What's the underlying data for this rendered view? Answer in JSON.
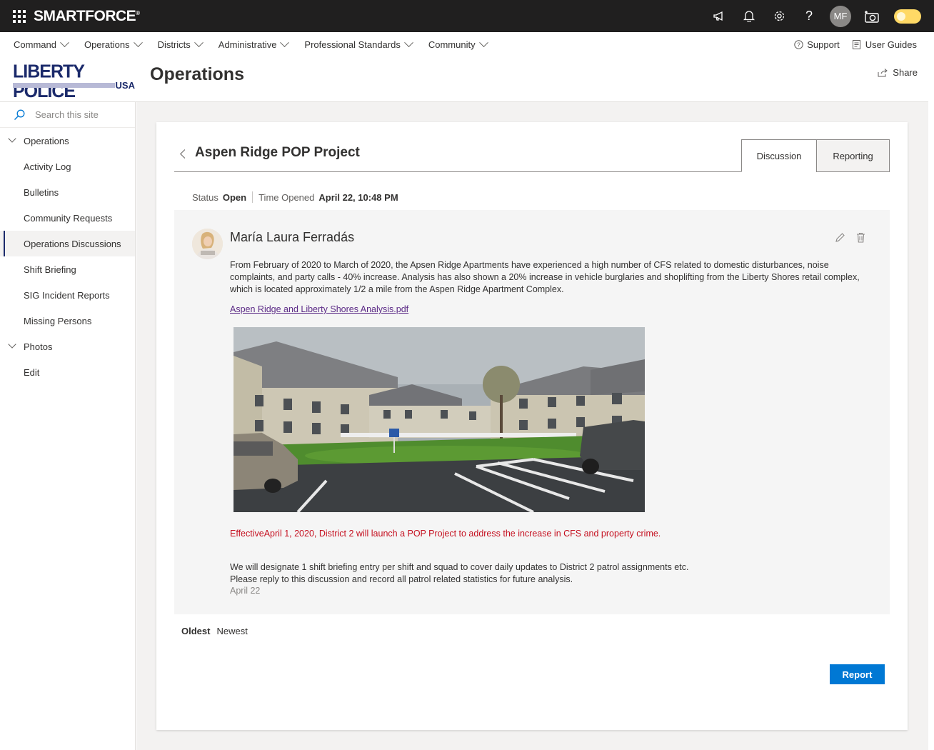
{
  "suite": {
    "brand": "SMARTFORCE",
    "brand_mark": "®",
    "user_initials": "MF",
    "icons": [
      "megaphone-icon",
      "bell-icon",
      "gear-icon",
      "help-icon",
      "camera-icon"
    ]
  },
  "topnav": {
    "items": [
      {
        "label": "Command"
      },
      {
        "label": "Operations"
      },
      {
        "label": "Districts"
      },
      {
        "label": "Administrative"
      },
      {
        "label": "Professional Standards"
      },
      {
        "label": "Community"
      }
    ],
    "support_label": "Support",
    "guides_label": "User Guides"
  },
  "site": {
    "logo_text": "LIBERTY POLICE",
    "logo_sub": "USA",
    "title": "Operations",
    "share_label": "Share"
  },
  "leftnav": {
    "search_placeholder": "Search this site",
    "items": [
      {
        "label": "Operations",
        "expandable": true
      },
      {
        "label": "Activity Log"
      },
      {
        "label": "Bulletins"
      },
      {
        "label": "Community Requests"
      },
      {
        "label": "Operations Discussions",
        "selected": true
      },
      {
        "label": "Shift Briefing"
      },
      {
        "label": "SIG Incident Reports"
      },
      {
        "label": "Missing Persons"
      },
      {
        "label": "Photos",
        "expandable": true
      },
      {
        "label": "Edit"
      }
    ]
  },
  "discussion": {
    "title": "Aspen Ridge POP Project",
    "tabs": [
      {
        "label": "Discussion",
        "active": true
      },
      {
        "label": "Reporting",
        "active": false
      }
    ],
    "status_label": "Status",
    "status_value": "Open",
    "opened_label": "Time Opened",
    "opened_value": "April 22, 10:48 PM",
    "post": {
      "author": "María Laura Ferradás",
      "body": "From February of 2020 to March of 2020, the Apsen Ridge Apartments have experienced a high number of CFS related to domestic disturbances, noise complaints, and party calls - 40% increase. Analysis has also shown a 20% increase in vehicle burglaries and shoplifting from the Liberty Shores retail complex, which is located approximately 1/2 a mile from the Aspen Ridge Apartment Complex.",
      "attachment": "Aspen Ridge and Liberty Shores Analysis.pdf",
      "highlight": "EffectiveApril 1, 2020, District 2 will launch a POP Project to address the increase in CFS and property crime.",
      "line1": "We will designate 1 shift briefing entry per shift and squad to cover daily updates to District 2 patrol assignments etc.",
      "line2": "Please reply to this discussion and record all patrol related statistics for future analysis.",
      "date": "April 22"
    },
    "sort_oldest": "Oldest",
    "sort_newest": "Newest",
    "report_label": "Report"
  },
  "colors": {
    "suite_bg": "#201f1f",
    "accent": "#0078d4",
    "highlight_text": "#c50f1f",
    "logo_navy": "#1b2a6b"
  }
}
